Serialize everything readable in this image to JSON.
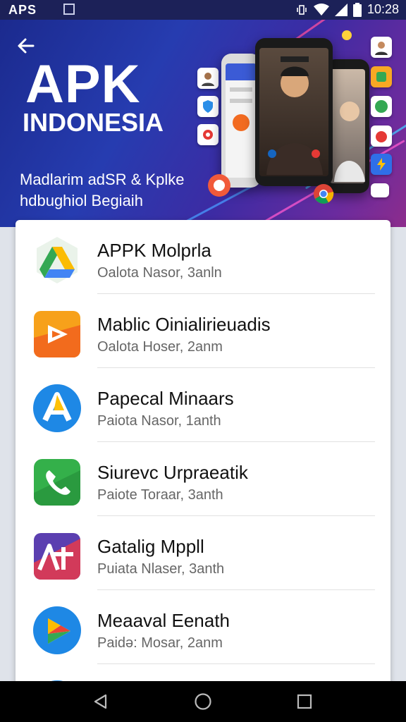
{
  "status_bar": {
    "left_text": "APS",
    "time": "10:28",
    "icons": [
      "notification-box-icon",
      "vibrate-icon",
      "wifi-icon",
      "signal-icon",
      "battery-icon"
    ]
  },
  "hero": {
    "title_line1": "APK",
    "title_line2": "INDONESIA",
    "subtitle_line1": "Madlarim adSR & Kplke",
    "subtitle_line2": "hdbughiol Begiaih"
  },
  "apps": [
    {
      "title": "APPK Molprla",
      "subtitle": "Oalota Nasor, 3anln",
      "icon": "drive-icon"
    },
    {
      "title": "Mablic Oinialirieuadis",
      "subtitle": "Oalota Hoser, 2anm",
      "icon": "play-tile-icon"
    },
    {
      "title": "Papecal Minaars",
      "subtitle": "Paiota Nasor, 1anth",
      "icon": "a-letter-icon"
    },
    {
      "title": "Siurevc Urpraeatik",
      "subtitle": "Paiote Toraar, 3anth",
      "icon": "phone-call-icon"
    },
    {
      "title": "Gatalig Mppll",
      "subtitle": "Puiata Nlaser, 3anth",
      "icon": "at-letter-icon"
    },
    {
      "title": "Meaaval Eenath",
      "subtitle": "Paidə: Mosar, 2anm",
      "icon": "play-arrow-icon"
    }
  ],
  "colors": {
    "status_bar": "#1c2158",
    "hero_start": "#1b2a8e",
    "hero_end": "#8d2c8c",
    "card": "#ffffff",
    "nav_bar": "#000000"
  },
  "nav": [
    "back-triangle-icon",
    "home-circle-icon",
    "recents-square-icon"
  ]
}
